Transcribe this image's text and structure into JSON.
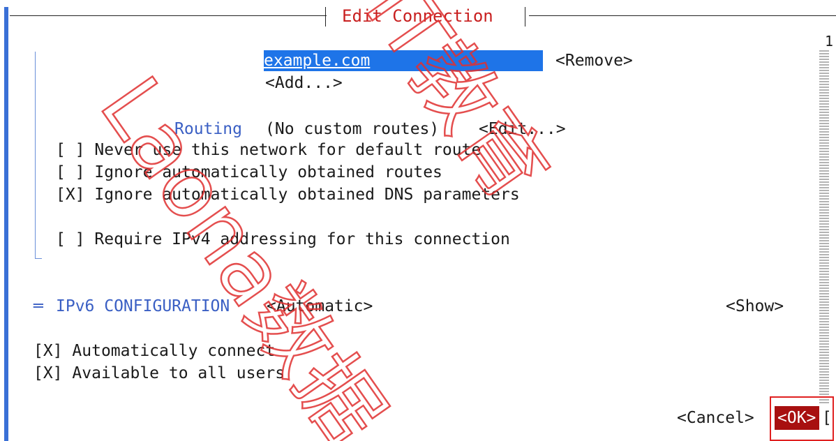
{
  "window": {
    "title": "Edit Connection",
    "scroll_indicator": "1"
  },
  "dns_search": {
    "domain_value": "example.com",
    "remove_label": "<Remove>",
    "add_label": "<Add...>"
  },
  "routing": {
    "label": "Routing",
    "status": "(No custom routes)",
    "edit_label": "<Edit...>"
  },
  "ipv4_options": [
    {
      "check": "[ ]",
      "label": "Never use this network for default route",
      "checked": false
    },
    {
      "check": "[ ]",
      "label": "Ignore automatically obtained routes",
      "checked": false
    },
    {
      "check": "[X]",
      "label": "Ignore automatically obtained DNS parameters",
      "checked": true
    }
  ],
  "require_ipv4": {
    "check": "[ ]",
    "label": "Require IPv4 addressing for this connection",
    "checked": false
  },
  "ipv6": {
    "marker": "═",
    "label": "IPv6 CONFIGURATION",
    "mode": "<Automatic>",
    "show_label": "<Show>"
  },
  "general_options": [
    {
      "check": "[X]",
      "label": "Automatically connect",
      "checked": true
    },
    {
      "check": "[X]",
      "label": "Available to all users",
      "checked": true
    }
  ],
  "footer": {
    "cancel_label": "<Cancel>",
    "ok_label": "<OK>",
    "trailing": "["
  },
  "watermark": {
    "text": "Laona数据 IT教育"
  },
  "colors": {
    "accent": "#1e74e8",
    "frame": "#3a70d6",
    "ok_bg": "#a81010",
    "title": "#c81e1e"
  }
}
